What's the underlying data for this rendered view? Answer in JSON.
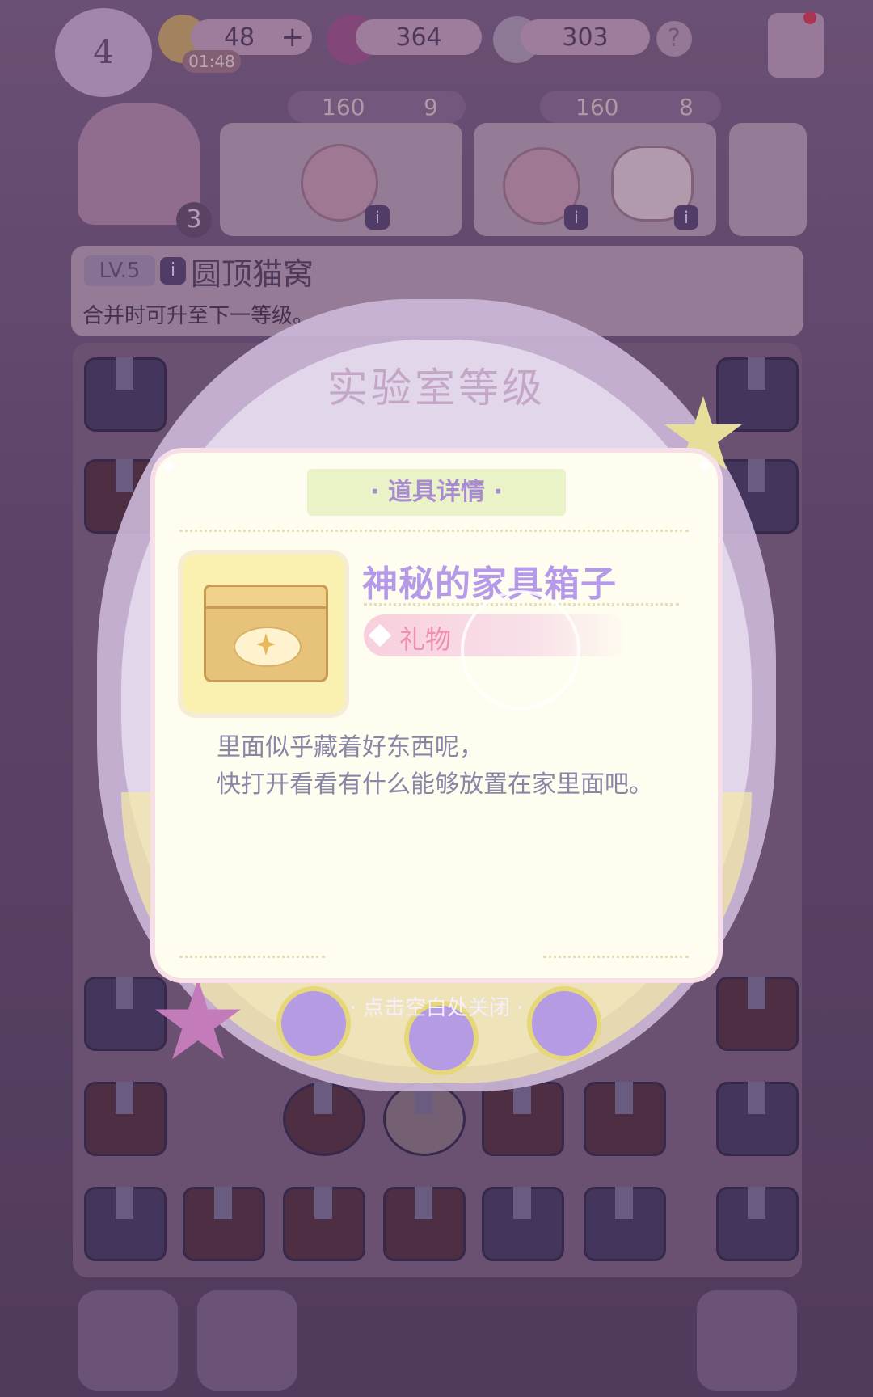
{
  "hud": {
    "player_level": "4",
    "energy": "48",
    "energy_plus": "+",
    "energy_timer": "01:48",
    "gems": "364",
    "stars": "303",
    "help": "?"
  },
  "orders": [
    {
      "coins": "160",
      "gems": "9"
    },
    {
      "coins": "160",
      "gems": "8"
    }
  ],
  "avatar": {
    "count": "3"
  },
  "info_icon": "i",
  "selected_item": {
    "level": "LV.5",
    "name": "圆顶猫窝",
    "hint": "合并时可升至下一等级。"
  },
  "overlay": {
    "lab_title": "实验室等级",
    "close_hint": "· 点击空白处关闭 ·"
  },
  "dialog": {
    "header": "· 道具详情 ·",
    "item_title": "神秘的家具箱子",
    "tag": "礼物",
    "description_lines": [
      "里面似乎藏着好东西呢，",
      "快打开看看有什么能够放置在家里面吧。"
    ]
  },
  "icons": [
    "energy-icon",
    "gem-icon",
    "star-rainbow-icon",
    "help-icon",
    "card-icon",
    "yarn-icon",
    "cat-toy-icon",
    "info-icon",
    "box-icon",
    "back-arrow-icon",
    "basket-icon",
    "cart-icon",
    "sparkle-icon"
  ]
}
